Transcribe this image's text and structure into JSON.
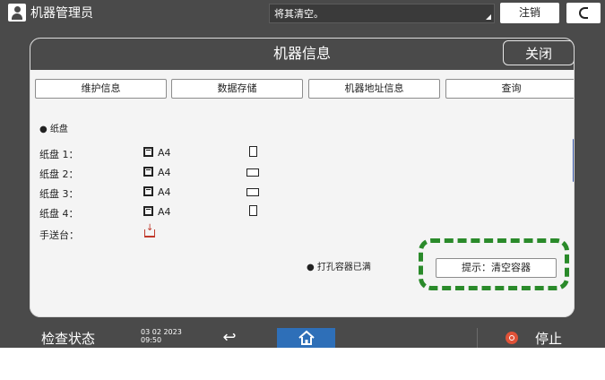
{
  "topbar": {
    "user_label": "机器管理员",
    "status_message": "将其清空。",
    "logout_label": "注销"
  },
  "panel": {
    "title": "机器信息",
    "close_label": "关闭",
    "tabs": [
      {
        "label": "维护信息"
      },
      {
        "label": "数据存储"
      },
      {
        "label": "机器地址信息"
      },
      {
        "label": "查询"
      }
    ],
    "section_title": "● 纸盘",
    "trays": [
      {
        "label": "纸盘 1：",
        "size": "A4",
        "orientation": "portrait"
      },
      {
        "label": "纸盘 2：",
        "size": "A4",
        "orientation": "landscape"
      },
      {
        "label": "纸盘 3：",
        "size": "A4",
        "orientation": "landscape"
      },
      {
        "label": "纸盘 4：",
        "size": "A4",
        "orientation": "portrait"
      }
    ],
    "bypass_label": "手送台：",
    "punch_status": "● 打孔容器已满",
    "hint_label": "提示：清空容器"
  },
  "bottombar": {
    "check_status_label": "检查状态",
    "date": "03 02 2023",
    "time": "09:50",
    "stop_label": "停止"
  },
  "colors": {
    "bar_bg": "#4a4a4a",
    "panel_bg": "#f4f4f4",
    "home_blue": "#2e6fb8",
    "stop_red": "#e05238",
    "highlight_green": "#2a8a2a",
    "scrollbar_blue": "#2f4fa3"
  },
  "icons": [
    "user-icon",
    "moon-icon",
    "paper-stack-icon",
    "paper-portrait-icon",
    "paper-landscape-icon",
    "bypass-tray-icon",
    "back-arrow-icon",
    "home-icon",
    "stop-icon"
  ]
}
